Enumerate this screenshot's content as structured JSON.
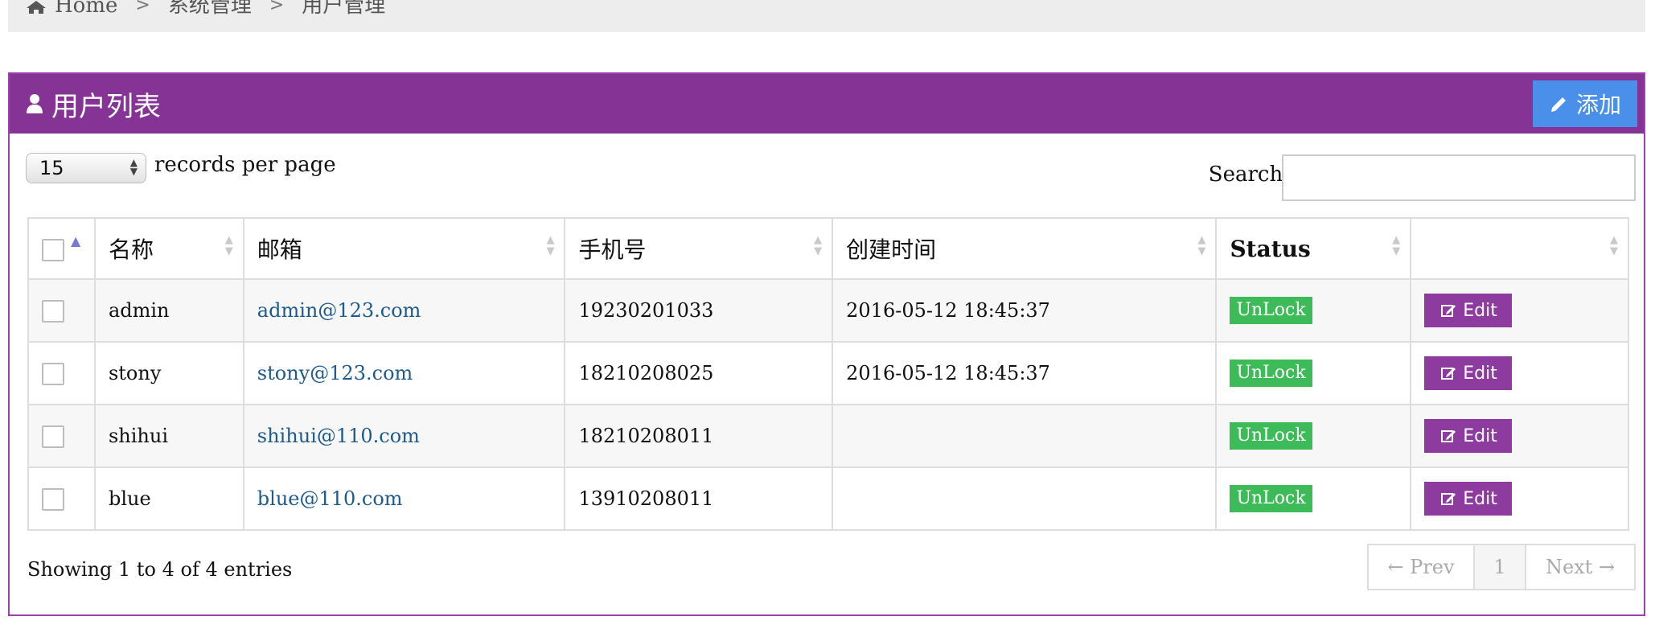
{
  "breadcrumb": {
    "items": [
      "Home",
      "系统管理",
      "用户管理"
    ],
    "separator": ">"
  },
  "panel": {
    "title": "用户列表",
    "add_label": "添加",
    "header_color": "#853395",
    "add_color": "#4a90ea"
  },
  "controls": {
    "page_length": "15",
    "page_length_label": "records per page",
    "search_label": "Search:",
    "search_value": ""
  },
  "table": {
    "columns": [
      "名称",
      "邮箱",
      "手机号",
      "创建时间",
      "Status",
      ""
    ],
    "rows": [
      {
        "name": "admin",
        "email": "admin@123.com",
        "phone": "19230201033",
        "created": "2016-05-12 18:45:37",
        "status": "UnLock",
        "action": "Edit"
      },
      {
        "name": "stony",
        "email": "stony@123.com",
        "phone": "18210208025",
        "created": "2016-05-12 18:45:37",
        "status": "UnLock",
        "action": "Edit"
      },
      {
        "name": "shihui",
        "email": "shihui@110.com",
        "phone": "18210208011",
        "created": "",
        "status": "UnLock",
        "action": "Edit"
      },
      {
        "name": "blue",
        "email": "blue@110.com",
        "phone": "13910208011",
        "created": "",
        "status": "UnLock",
        "action": "Edit"
      }
    ]
  },
  "footer": {
    "info": "Showing 1 to 4 of 4 entries",
    "prev_label": "← Prev",
    "current_page": "1",
    "next_label": "Next →"
  },
  "icons": {
    "home": "home-icon",
    "user": "user-icon",
    "pencil": "pencil-icon",
    "edit": "edit-icon"
  }
}
